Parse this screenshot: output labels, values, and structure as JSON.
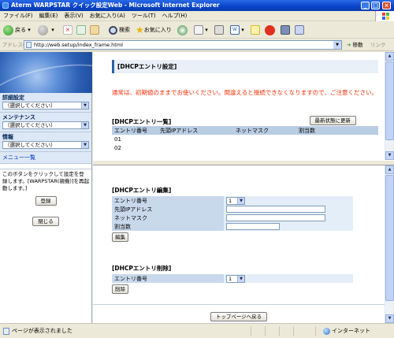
{
  "window": {
    "title": "Aterm WARPSTAR クイック設定Web - Microsoft Internet Explorer"
  },
  "menubar": {
    "items": [
      "ファイル(F)",
      "編集(E)",
      "表示(V)",
      "お気に入り(A)",
      "ツール(T)",
      "ヘルプ(H)"
    ]
  },
  "toolbar": {
    "back": "戻る",
    "search": "検索",
    "favorites": "お気に入り"
  },
  "addressbar": {
    "label": "アドレス(D)",
    "url": "http://web.setup/index_frame.html",
    "go": "移動",
    "links": "リンク"
  },
  "sidebar": {
    "advanced_label": "詳細設定",
    "advanced_value": "（選択してください）",
    "maintenance_label": "メンテナンス",
    "maintenance_value": "（選択してください）",
    "info_label": "情報",
    "info_value": "（選択してください）",
    "menu_link": "メニュー一覧",
    "note": "このボタンをクリックして設定を登録します。[WARPSTAR(親機)]を再起動します。]",
    "register_button": "登録",
    "close_button": "閉じる"
  },
  "top": {
    "heading": "[DHCPエントリ設定]",
    "warning": "通常は、初期値のままでお使いください。間違えると接続できなくなりますので、ご注意ください。",
    "list_heading": "[DHCPエントリ一覧]",
    "refresh_button": "最新状態に更新",
    "columns": [
      "エントリ番号",
      "先頭IPアドレス",
      "ネットマスク",
      "割当数"
    ],
    "rows": [
      [
        "01",
        "",
        "",
        ""
      ],
      [
        "02",
        "",
        "",
        ""
      ]
    ]
  },
  "edit": {
    "heading": "[DHCPエントリ編集]",
    "entry_label": "エントリ番号",
    "entry_value": "1",
    "ip_label": "先頭IPアドレス",
    "ip_value": "",
    "mask_label": "ネットマスク",
    "mask_value": "",
    "count_label": "割当数",
    "count_value": "",
    "button": "編集"
  },
  "delete": {
    "heading": "[DHCPエントリ削除]",
    "entry_label": "エントリ番号",
    "entry_value": "1",
    "button": "削除"
  },
  "top_page_button": "トップページへ戻る",
  "status": {
    "text": "ページが表示されました",
    "zone": "インターネット"
  }
}
